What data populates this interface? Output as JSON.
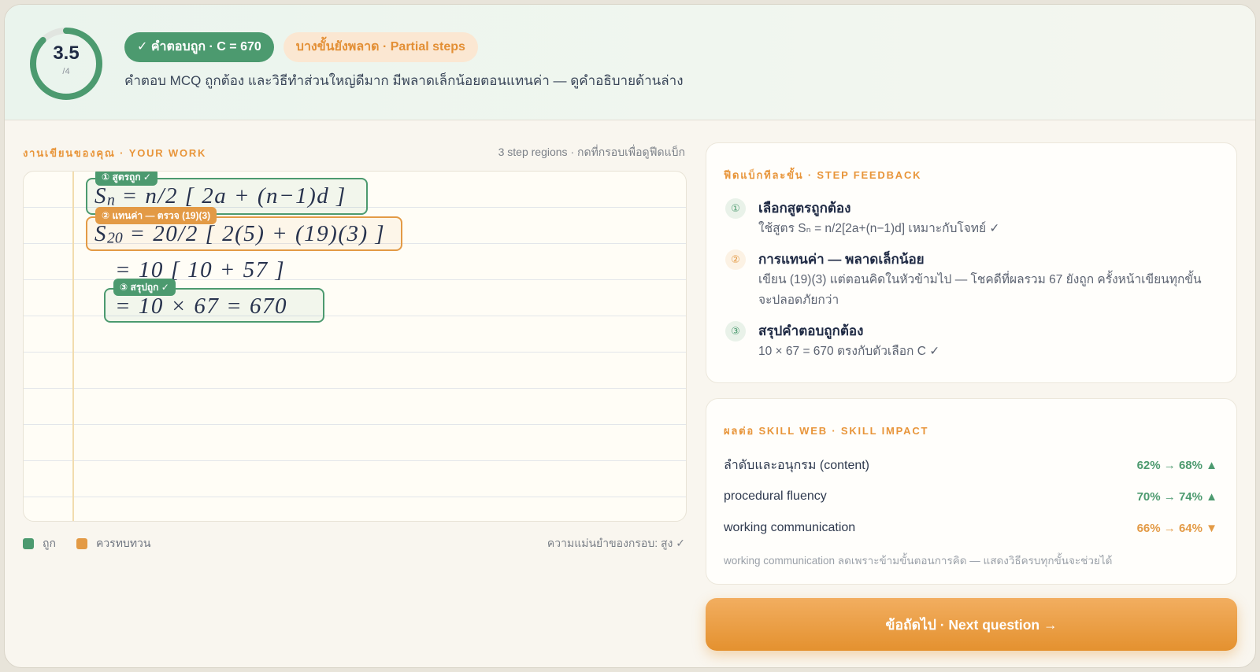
{
  "colors": {
    "correct": "#4c9a6f",
    "review": "#e39a45",
    "label": "#e8953a",
    "partial_text": "#e38f35",
    "ring_track": "#e1e5e0"
  },
  "header": {
    "score": {
      "value": "3.5",
      "max": "/4",
      "fraction": 0.875
    },
    "badge_correct": "✓ คำตอบถูก · C = 670",
    "badge_partial": "บางขั้นยังพลาด · Partial steps",
    "summary": "คำตอบ MCQ ถูกต้อง และวิธีทำส่วนใหญ่ดีมาก มีพลาดเล็กน้อยตอนแทนค่า — ดูคำอธิบายด้านล่าง"
  },
  "work": {
    "label": "งานเขียนของคุณ · YOUR WORK",
    "hint": "3 step regions · กดที่กรอบเพื่อดูฟีดแบ็ก",
    "lines": [
      {
        "symbol": "S",
        "sub": "n",
        "rest": " = n/2 [ 2a + (n−1)d ]"
      },
      {
        "symbol": "S",
        "sub": "20",
        "rest": " = 20/2 [ 2(5) + (19)(3) ]"
      },
      {
        "text": "= 10 [ 10 + 57 ]"
      },
      {
        "text": "= 10 × 67 = 670"
      }
    ],
    "regions": [
      {
        "tag": "① สูตรถูก ✓",
        "color": "#4c9a6f"
      },
      {
        "tag": "② แทนค่า — ตรวจ (19)(3)",
        "color": "#e39a45"
      },
      {
        "tag": "③ สรุปถูก ✓",
        "color": "#4c9a6f"
      }
    ],
    "legend": {
      "correct": "ถูก",
      "review": "ควรทบทวน",
      "accuracy": "ความแม่นยำของกรอบ: สูง ✓"
    }
  },
  "feedback": {
    "label": "ฟีดแบ็กทีละขั้น · STEP FEEDBACK",
    "steps": [
      {
        "num": "①",
        "title": "เลือกสูตรถูกต้อง",
        "desc": "ใช้สูตร Sₙ = n/2[2a+(n−1)d] เหมาะกับโจทย์ ✓",
        "color": "#4c9a6f"
      },
      {
        "num": "②",
        "title": "การแทนค่า — พลาดเล็กน้อย",
        "desc": "เขียน (19)(3) แต่ตอนคิดในหัวข้ามไป — โชคดีที่ผลรวม 67 ยังถูก ครั้งหน้าเขียนทุกขั้น จะปลอดภัยกว่า",
        "color": "#e39a45"
      },
      {
        "num": "③",
        "title": "สรุปคำตอบถูกต้อง",
        "desc": "10 × 67 = 670 ตรงกับตัวเลือก C ✓",
        "color": "#4c9a6f"
      }
    ]
  },
  "skills": {
    "label": "ผลต่อ SKILL WEB · SKILL IMPACT",
    "rows": [
      {
        "name": "ลำดับและอนุกรม (content)",
        "change": "62% → 68% ▲",
        "color": "#4c9a6f"
      },
      {
        "name": "procedural fluency",
        "change": "70% → 74% ▲",
        "color": "#4c9a6f"
      },
      {
        "name": "working communication",
        "change": "66% → 64% ▼",
        "color": "#e39a45"
      }
    ],
    "note": "working communication ลดเพราะข้ามขั้นตอนการคิด — แสดงวิธีครบทุกขั้นจะช่วยได้"
  },
  "next_button": "ข้อถัดไป · Next question →"
}
